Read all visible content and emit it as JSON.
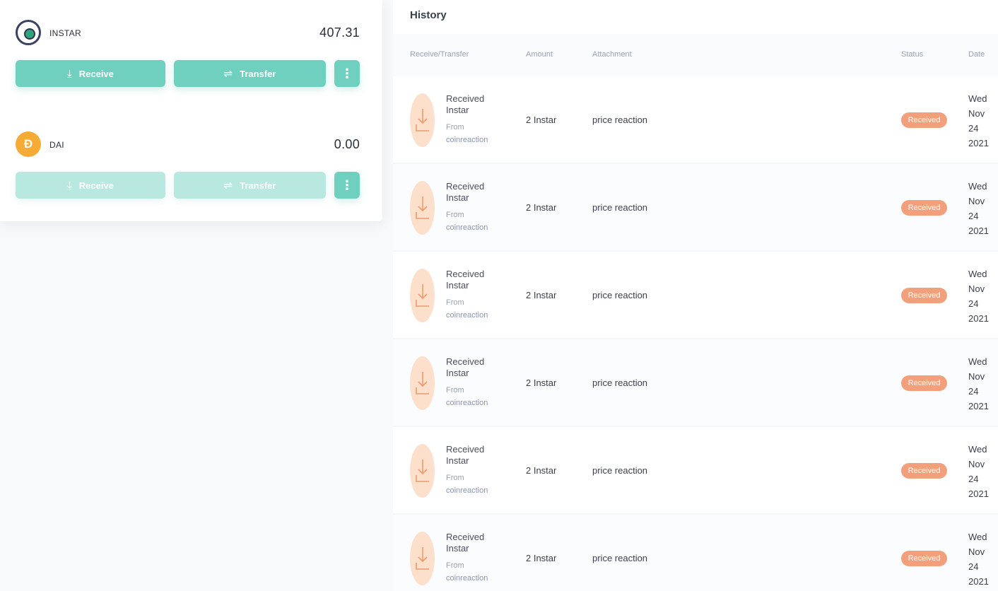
{
  "wallet": {
    "assets": [
      {
        "name": "INSTAR",
        "balance": "407.31",
        "icon": "instar-logo-icon",
        "receive_label": "Receive",
        "transfer_label": "Transfer"
      },
      {
        "name": "DAI",
        "balance": "0.00",
        "icon": "dai-logo-icon",
        "icon_glyph": "Đ",
        "receive_label": "Receive",
        "transfer_label": "Transfer"
      }
    ]
  },
  "history": {
    "title": "History",
    "columns": {
      "type": "Receive/Transfer",
      "amount": "Amount",
      "attachment": "Attachment",
      "status": "Status",
      "date": "Date"
    },
    "rows": [
      {
        "type": "Received Instar",
        "from_label": "From",
        "from": "coinreaction",
        "amount": "2 Instar",
        "attachment": "price reaction",
        "status": "Received",
        "date": "Wed Nov 24 2021"
      },
      {
        "type": "Received Instar",
        "from_label": "From",
        "from": "coinreaction",
        "amount": "2 Instar",
        "attachment": "price reaction",
        "status": "Received",
        "date": "Wed Nov 24 2021"
      },
      {
        "type": "Received Instar",
        "from_label": "From",
        "from": "coinreaction",
        "amount": "2 Instar",
        "attachment": "price reaction",
        "status": "Received",
        "date": "Wed Nov 24 2021"
      },
      {
        "type": "Received Instar",
        "from_label": "From",
        "from": "coinreaction",
        "amount": "2 Instar",
        "attachment": "price reaction",
        "status": "Received",
        "date": "Wed Nov 24 2021"
      },
      {
        "type": "Received Instar",
        "from_label": "From",
        "from": "coinreaction",
        "amount": "2 Instar",
        "attachment": "price reaction",
        "status": "Received",
        "date": "Wed Nov 24 2021"
      },
      {
        "type": "Received Instar",
        "from_label": "From",
        "from": "coinreaction",
        "amount": "2 Instar",
        "attachment": "price reaction",
        "status": "Received",
        "date": "Wed Nov 24 2021"
      }
    ]
  },
  "colors": {
    "accent": "#6fd0bf",
    "accent_disabled": "#b8e8e0",
    "status_received": "#f2a07b",
    "dai": "#f5ac37"
  }
}
